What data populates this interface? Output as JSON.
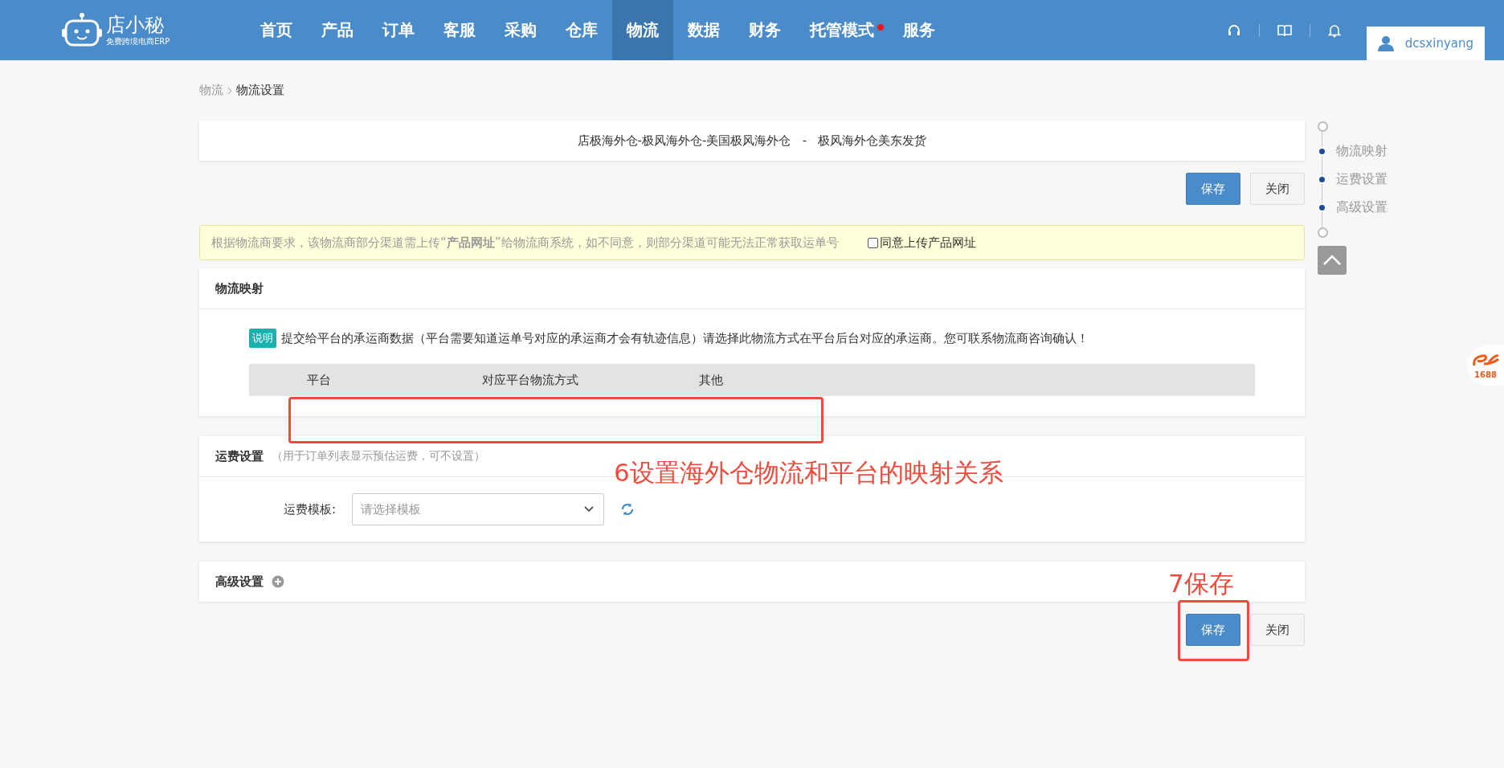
{
  "header": {
    "logo_text": "店小秘",
    "logo_subtitle": "免费跨境电商ERP",
    "nav": [
      {
        "label": "首页",
        "selected": false,
        "dot": false
      },
      {
        "label": "产品",
        "selected": false,
        "dot": false
      },
      {
        "label": "订单",
        "selected": false,
        "dot": false
      },
      {
        "label": "客服",
        "selected": false,
        "dot": false
      },
      {
        "label": "采购",
        "selected": false,
        "dot": false
      },
      {
        "label": "仓库",
        "selected": false,
        "dot": false
      },
      {
        "label": "物流",
        "selected": true,
        "dot": false
      },
      {
        "label": "数据",
        "selected": false,
        "dot": false
      },
      {
        "label": "财务",
        "selected": false,
        "dot": false
      },
      {
        "label": "托管模式",
        "selected": false,
        "dot": true
      },
      {
        "label": "服务",
        "selected": false,
        "dot": false
      }
    ],
    "username": "dcsxinyang"
  },
  "breadcrumb": [
    "物流",
    "物流设置"
  ],
  "title": "店极海外仓-极风海外仓-美国极风海外仓   -   极风海外仓美东发货",
  "buttons": [
    "保存",
    "关闭"
  ],
  "notice": {
    "text": "根据物流商要求，该物流商部分渠道需上传“**产品网址**”给物流商系统，如不同意，则部分渠道可能无法正常获取运单号",
    "checkbox_label": "同意上传产品网址",
    "checked": false
  },
  "mapping": {
    "title": "物流映射",
    "tag": "说明",
    "description": "提交给平台的承运商数据（平台需要知道运单号对应的承运商才会有轨迹信息）请选择此物流方式在平台后台对应的承运商。您可联系物流商咨询确认！",
    "columns": [
      "平台",
      "对应平台物流方式",
      "其他"
    ]
  },
  "freight": {
    "title": "运费设置",
    "hint": "（用于订单列表显示预估运费，可不设置）",
    "label": "运费模板:",
    "placeholder": "请选择模板"
  },
  "advanced": {
    "title": "高级设置",
    "expanded": false
  },
  "bottom_buttons": [
    "保存",
    "关闭"
  ],
  "side_nav": [
    "物流映射",
    "运费设置",
    "高级设置"
  ],
  "floating_logo_text": "1688",
  "annotations": [
    "6设置海外仓物流和平台的映射关系",
    "7保存"
  ]
}
